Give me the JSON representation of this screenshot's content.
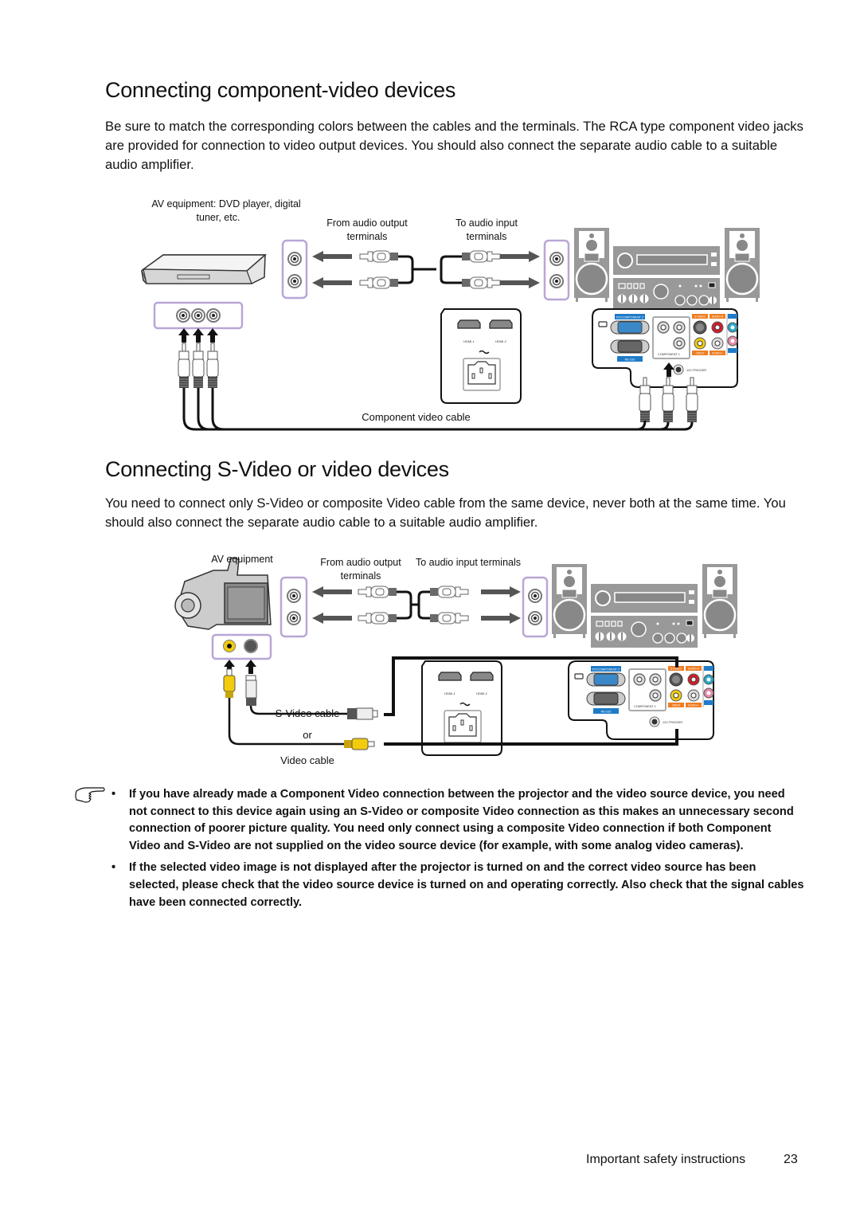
{
  "section1": {
    "title": "Connecting component-video devices",
    "body": "Be sure to match the corresponding colors between the cables and the terminals. The RCA type component video jacks are provided for connection to video output devices. You should also connect the separate audio cable to a suitable audio amplifier.",
    "diagram": {
      "source_label_line1": "AV equipment: DVD player, digital",
      "source_label_line2": "tuner, etc.",
      "from_audio_line1": "From audio output",
      "from_audio_line2": "terminals",
      "to_audio_line1": "To audio input",
      "to_audio_line2": "terminals",
      "cable_label": "Component video cable",
      "projector_port_labels": {
        "pc_component2": "PC/COMPONENT 2",
        "rs232": "RS-232",
        "component1": "COMPONENT 1",
        "svideo": "S-VIDEO",
        "video": "VIDEO",
        "audio_r": "AUDIO-R",
        "audio_l": "AUDIO-L",
        "audio_in": "AUDIO-IN",
        "audio_out": "AUDIO-OUT",
        "trigger": "12V-TRIGGER",
        "hdmi1": "HDMI-1",
        "hdmi2": "HDMI-2"
      }
    }
  },
  "section2": {
    "title": "Connecting S-Video or video devices",
    "body": "You need to connect only S-Video or composite Video cable from the same device, never both at the same time. You should also connect the separate audio cable to a suitable audio amplifier.",
    "diagram": {
      "source_label": "AV equipment",
      "from_audio_line1": "From audio output",
      "from_audio_line2": "terminals",
      "to_audio": "To audio input terminals",
      "svideo_cable": "S-Video cable",
      "or": "or",
      "video_cable": "Video cable"
    }
  },
  "notes": {
    "icon": "pointing-hand-icon",
    "bullet": "•",
    "items": [
      "If you have already made a Component Video connection between the projector and the video source device, you need not connect to this device again using an S-Video or composite Video connection as this makes an unnecessary second connection of poorer picture quality. You need only connect using a composite Video connection if both Component Video and S-Video are not supplied on the video source device (for example, with some analog video cameras).",
      "If the selected video image is not displayed after the projector is turned on and the correct video source has been selected, please check that the video source device is turned on and operating correctly. Also check that the signal cables have been connected correctly."
    ]
  },
  "footer": {
    "section": "Important safety instructions",
    "page": "23"
  },
  "colors": {
    "terminal_box": "#b9a6d6",
    "blue_label": "#1f7bc8",
    "orange_label": "#ef7d22",
    "red_jack": "#d51d2a",
    "yellow_jack": "#f2cc0c",
    "cyan_jack": "#29a8c8",
    "pink_jack": "#e58aa6",
    "gray_device": "#8e8e8e",
    "arrow_gray": "#555555"
  }
}
